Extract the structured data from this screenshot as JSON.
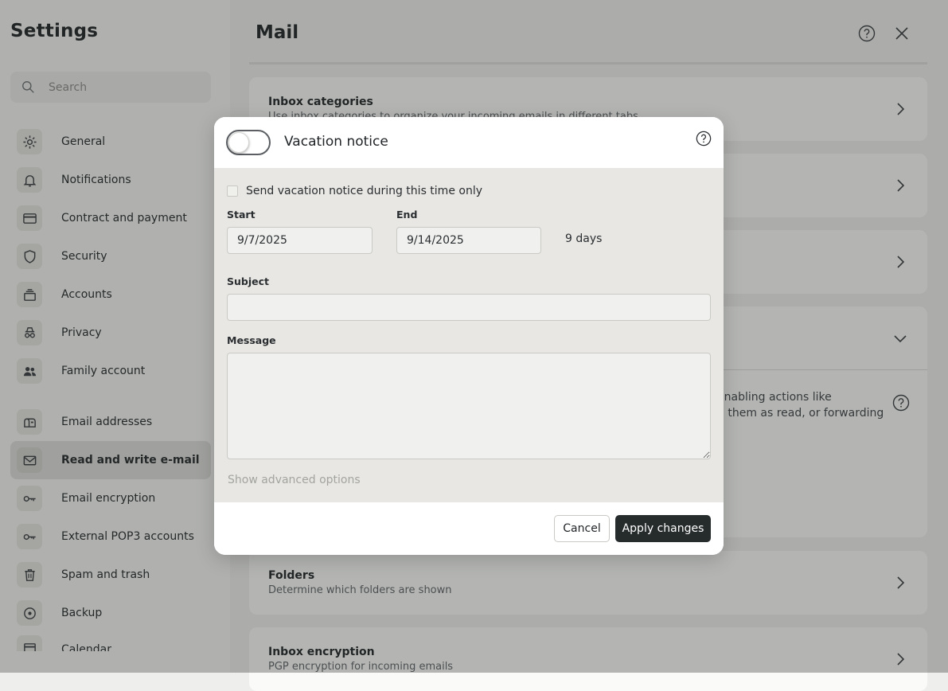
{
  "sidebar": {
    "title": "Settings",
    "search_placeholder": "Search",
    "items": [
      {
        "label": "General",
        "icon": "gear-icon"
      },
      {
        "label": "Notifications",
        "icon": "bell-icon"
      },
      {
        "label": "Contract and payment",
        "icon": "credit-card-icon"
      },
      {
        "label": "Security",
        "icon": "shield-icon"
      },
      {
        "label": "Accounts",
        "icon": "stack-icon"
      },
      {
        "label": "Privacy",
        "icon": "incognito-icon"
      },
      {
        "label": "Family account",
        "icon": "people-icon"
      },
      {
        "label": "Email addresses",
        "icon": "mailbox-icon"
      },
      {
        "label": "Read and write e-mail",
        "icon": "envelope-icon",
        "active": true
      },
      {
        "label": "Email encryption",
        "icon": "key-icon"
      },
      {
        "label": "External POP3 accounts",
        "icon": "key-icon"
      },
      {
        "label": "Spam and trash",
        "icon": "trash-icon"
      },
      {
        "label": "Backup",
        "icon": "disc-icon"
      },
      {
        "label": "Calendar",
        "icon": "calendar-icon"
      }
    ]
  },
  "main": {
    "title": "Mail",
    "cards": [
      {
        "title": "Inbox categories",
        "description": "Use inbox categories to organize your incoming emails in different tabs"
      },
      {
        "title": "Folders",
        "description": "Determine which folders are shown"
      },
      {
        "title": "Inbox encryption",
        "description": "PGP encryption for incoming emails"
      }
    ],
    "expanded_text_line1": "enabling actions like",
    "expanded_text_line2": "g them as read, or forwarding"
  },
  "modal": {
    "title": "Vacation notice",
    "toggle_on": false,
    "checkbox_label": "Send vacation notice during this time only",
    "start_label": "Start",
    "start_value": "9/7/2025",
    "end_label": "End",
    "end_value": "9/14/2025",
    "duration": "9 days",
    "subject_label": "Subject",
    "subject_value": "",
    "message_label": "Message",
    "message_value": "",
    "advanced_label": "Show advanced options",
    "cancel_label": "Cancel",
    "apply_label": "Apply changes"
  },
  "colors": {
    "accent_dark": "#262b2c",
    "overlay": "#282c26"
  }
}
